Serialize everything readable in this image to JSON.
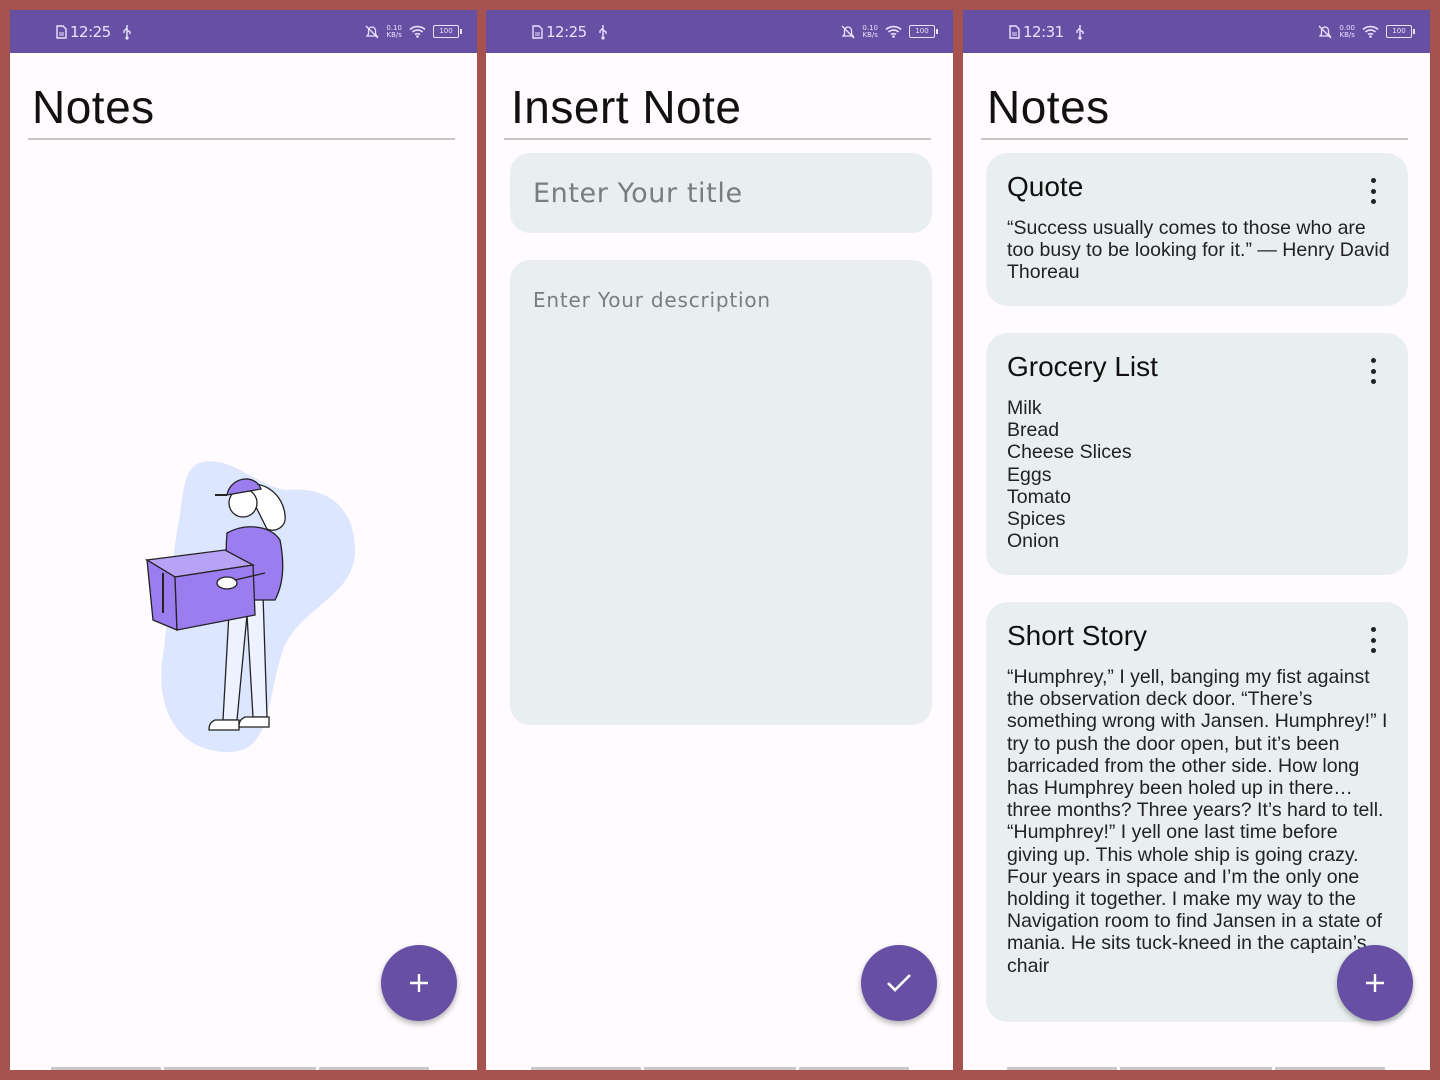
{
  "screens": [
    {
      "status": {
        "time": "12:25",
        "speed_top": "0.10",
        "speed_bottom": "KB/s",
        "battery": "100"
      },
      "title": "Notes",
      "fab_icon": "+"
    },
    {
      "status": {
        "time": "12:25",
        "speed_top": "0.10",
        "speed_bottom": "KB/s",
        "battery": "100"
      },
      "title": "Insert Note",
      "title_placeholder": "Enter Your title",
      "description_placeholder": "Enter Your description",
      "fab_icon": "✓"
    },
    {
      "status": {
        "time": "12:31",
        "speed_top": "0.00",
        "speed_bottom": "KB/s",
        "battery": "100"
      },
      "title": "Notes",
      "fab_icon": "+",
      "notes": [
        {
          "title": "Quote",
          "body": "“Success usually comes to those who are too busy to be looking for it.” — Henry David Thoreau"
        },
        {
          "title": "Grocery List",
          "body": "Milk\nBread\nCheese Slices\nEggs\nTomato\nSpices\nOnion"
        },
        {
          "title": "Short Story",
          "body": "“Humphrey,” I yell, banging my fist against the observation deck door. “There’s something wrong with Jansen. Humphrey!” I try to push the door open, but it’s been barricaded from the other side. How long has Humphrey been holed up in there…three months? Three years? It’s hard to tell. “Humphrey!” I yell one last time before giving up. This whole ship is going crazy. Four years in space and I’m the only one holding it together. I make my way to the Navigation room to find Jansen in a state of mania. He sits tuck-kneed in the captain’s chair"
        }
      ]
    }
  ],
  "colors": {
    "primary": "#6750a4",
    "background": "#fffbfe",
    "card": "#e9eff0",
    "frame": "#a65350",
    "illustration_purple": "#9b7df0",
    "illustration_blob": "#dde6ff"
  },
  "icons": [
    "file-icon",
    "usb-icon",
    "mute-icon",
    "wifi-icon",
    "battery-icon",
    "plus-icon",
    "check-icon",
    "more-vert-icon"
  ]
}
